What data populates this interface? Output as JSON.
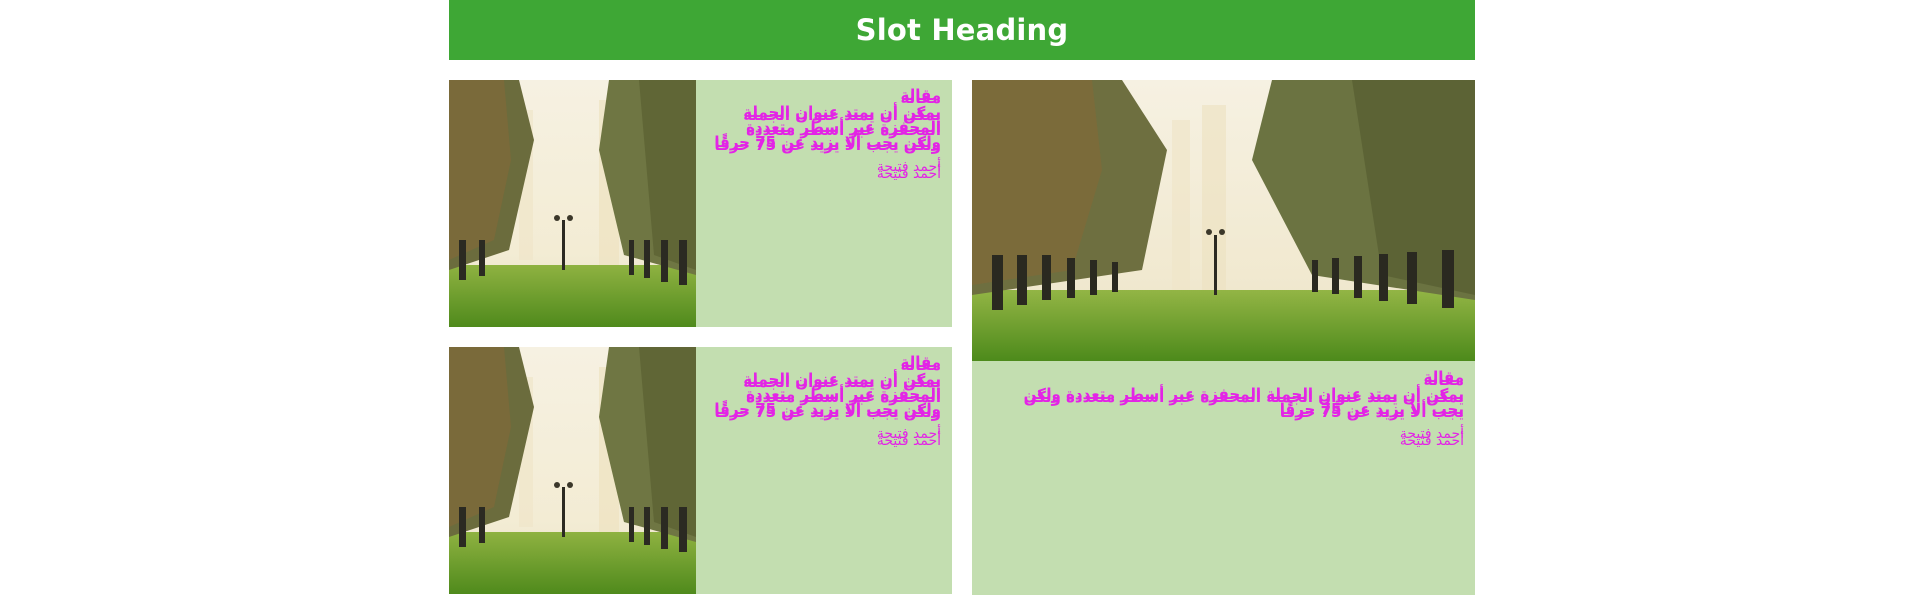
{
  "slot": {
    "heading": "Slot Heading"
  },
  "cards": [
    {
      "kicker": "مقالة",
      "headline": "يمكن أن يمتد عنوان الجملة المحفزة عبر أسطر متعددة ولكن يجب ألا يزيد عن 75 حرفًا",
      "author": "أحمد فتيحة",
      "image": "palm-avenue-park-photo"
    },
    {
      "kicker": "مقالة",
      "headline": "يمكن أن يمتد عنوان الجملة المحفزة عبر أسطر متعددة ولكن يجب ألا يزيد عن 75 حرفًا",
      "author": "أحمد فتيحة",
      "image": "palm-avenue-park-photo"
    },
    {
      "kicker": "مقالة",
      "headline": "يمكن أن يمتد عنوان الجملة المحفزة عبر أسطر متعددة ولكن يجب ألا يزيد عن 75 حرفًا",
      "author": "أحمد فتيحة",
      "image": "palm-avenue-park-photo"
    }
  ],
  "colors": {
    "heading_bg": "#3ea735",
    "card_bg": "#c3deb0",
    "text_accent": "#e324e6"
  }
}
